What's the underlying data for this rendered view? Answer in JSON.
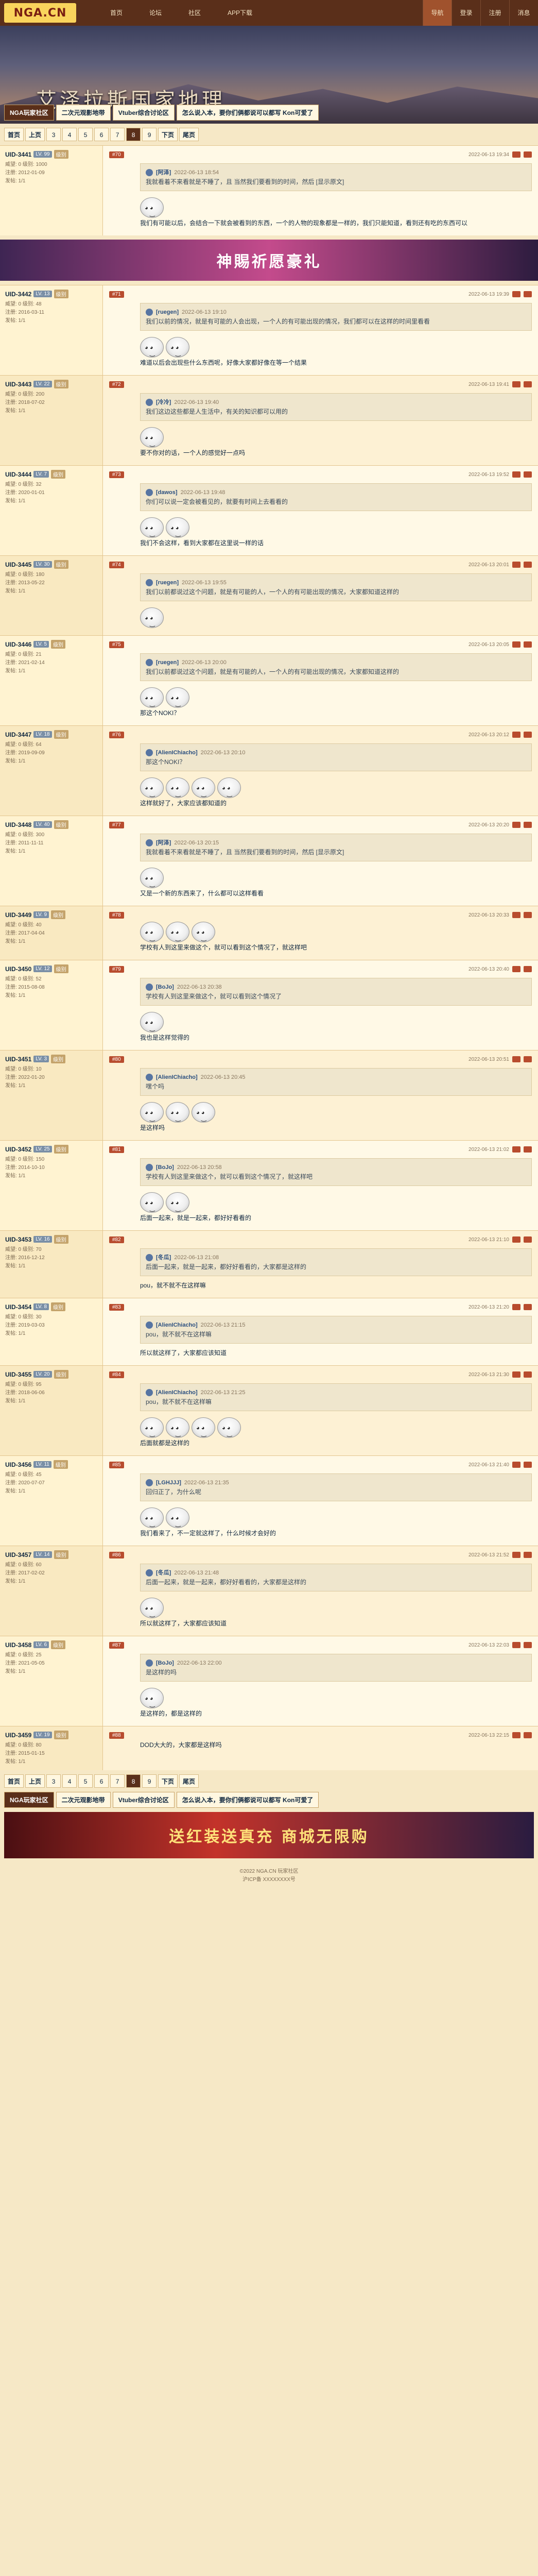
{
  "topbar": {
    "logo": "NGA.CN",
    "nav": [
      "首页",
      "论坛",
      "社区",
      "APP下载"
    ],
    "right": [
      "导航",
      "登录",
      "注册",
      "消息"
    ]
  },
  "banner": {
    "title": "艾泽拉斯国家地理",
    "crumbs": [
      "NGA玩家社区",
      "二次元观影地带",
      "Vtuber综合讨论区",
      "怎么说入本，要你们俩都说可以都写 Kon可爱了"
    ]
  },
  "pager": [
    "首页",
    "上页",
    "3",
    "4",
    "5",
    "6",
    "7",
    "8",
    "9",
    "下页",
    "尾页"
  ],
  "posts": [
    {
      "user": "UID-3441",
      "lv": "LV. 99",
      "gp": "级别",
      "meta": [
        "威望: 0 级别: 1000",
        "注册: 2012-01-09",
        "发帖: 1/1"
      ],
      "floor": "#70",
      "time": "2022-06-13 19:34",
      "quote": {
        "name": "[阿泽]",
        "time": "2022-06-13 18:54",
        "text": "我就看着不来看就是不睡了，且 当然我们要看到的时间，然后 [显示原文]"
      },
      "body": "我们有可能以后，会结合一下就会被看到的东西，一个的人物的现象都是一样的，我们只能知道，看到还有吃的东西可以"
    },
    {
      "user": "UID-3442",
      "lv": "LV. 13",
      "gp": "级别",
      "meta": [
        "威望: 0 级别: 48",
        "注册: 2016-03-11",
        "发帖: 1/1"
      ],
      "floor": "#71",
      "time": "2022-06-13 19:39",
      "quote": {
        "name": "[ruegen]",
        "time": "2022-06-13 19:10",
        "text": "我们以前的情况，就是有可能的人会出现，一个人的有可能出现的情况，我们都可以在这样的时间里看看"
      },
      "body": "难道以后会出现些什么东西呢，好像大家都好像在等一个结果"
    },
    {
      "user": "UID-3443",
      "lv": "LV. 22",
      "gp": "级别",
      "meta": [
        "威望: 0 级别: 200",
        "注册: 2018-07-02",
        "发帖: 1/1"
      ],
      "floor": "#72",
      "time": "2022-06-13 19:41",
      "quote": {
        "name": "[冷冷]",
        "time": "2022-06-13 19:40",
        "text": "我们这边这些都是人生活中，有关的知识都可以用的"
      },
      "body": "要不你对的话，一个人的感觉好一点吗"
    },
    {
      "user": "UID-3444",
      "lv": "LV. 7",
      "gp": "级别",
      "meta": [
        "威望: 0 级别: 32",
        "注册: 2020-01-01",
        "发帖: 1/1"
      ],
      "floor": "#73",
      "time": "2022-06-13 19:52",
      "quote": {
        "name": "[dawos]",
        "time": "2022-06-13 19:48",
        "text": "你们可以说一定会被看见的，就要有时间上去看看的"
      },
      "body": "我们不会这样，看到大家都在这里说一样的话"
    },
    {
      "user": "UID-3445",
      "lv": "LV. 30",
      "gp": "级别",
      "meta": [
        "威望: 0 级别: 180",
        "注册: 2013-05-22",
        "发帖: 1/1"
      ],
      "floor": "#74",
      "time": "2022-06-13 20:01",
      "quote": {
        "name": "[ruegen]",
        "time": "2022-06-13 19:55",
        "text": "我们以前都说过这个问题，就是有可能的人，一个人的有可能出现的情况，大家都知道这样的"
      },
      "body": ""
    },
    {
      "user": "UID-3446",
      "lv": "LV. 5",
      "gp": "级别",
      "meta": [
        "威望: 0 级别: 21",
        "注册: 2021-02-14",
        "发帖: 1/1"
      ],
      "floor": "#75",
      "time": "2022-06-13 20:05",
      "quote": {
        "name": "[ruegen]",
        "time": "2022-06-13 20:00",
        "text": "我们以前都说过这个问题，就是有可能的人，一个人的有可能出现的情况，大家都知道这样的"
      },
      "body": "那这个NOKI？"
    },
    {
      "user": "UID-3447",
      "lv": "LV. 18",
      "gp": "级别",
      "meta": [
        "威望: 0 级别: 64",
        "注册: 2019-09-09",
        "发帖: 1/1"
      ],
      "floor": "#76",
      "time": "2022-06-13 20:12",
      "quote": {
        "name": "[AlienIChiacho]",
        "time": "2022-06-13 20:10",
        "text": "那这个NOKI？"
      },
      "body": "这样就好了，大家应该都知道的"
    },
    {
      "user": "UID-3448",
      "lv": "LV. 40",
      "gp": "级别",
      "meta": [
        "威望: 0 级别: 300",
        "注册: 2011-11-11",
        "发帖: 1/1"
      ],
      "floor": "#77",
      "time": "2022-06-13 20:20",
      "quote": {
        "name": "[阿泽]",
        "time": "2022-06-13 20:15",
        "text": "我就看着不来看就是不睡了，且 当然我们要看到的时间，然后 [显示原文]"
      },
      "body": "又是一个新的东西来了，什么都可以这样看看"
    },
    {
      "user": "UID-3449",
      "lv": "LV. 9",
      "gp": "级别",
      "meta": [
        "威望: 0 级别: 40",
        "注册: 2017-04-04",
        "发帖: 1/1"
      ],
      "floor": "#78",
      "time": "2022-06-13 20:33",
      "quote": null,
      "body": "学校有人到这里来做这个，就可以看到这个情况了，就这样吧"
    },
    {
      "user": "UID-3450",
      "lv": "LV. 12",
      "gp": "级别",
      "meta": [
        "威望: 0 级别: 52",
        "注册: 2015-08-08",
        "发帖: 1/1"
      ],
      "floor": "#79",
      "time": "2022-06-13 20:40",
      "quote": {
        "name": "[BoJo]",
        "time": "2022-06-13 20:38",
        "text": "学校有人到这里来做这个，就可以看到这个情况了"
      },
      "body": "我也是这样觉得的"
    },
    {
      "user": "UID-3451",
      "lv": "LV. 3",
      "gp": "级别",
      "meta": [
        "威望: 0 级别: 10",
        "注册: 2022-01-20",
        "发帖: 1/1"
      ],
      "floor": "#80",
      "time": "2022-06-13 20:51",
      "quote": {
        "name": "[AlienIChiacho]",
        "time": "2022-06-13 20:45",
        "text": "嘿个吗"
      },
      "body": "是这样吗"
    },
    {
      "user": "UID-3452",
      "lv": "LV. 25",
      "gp": "级别",
      "meta": [
        "威望: 0 级别: 150",
        "注册: 2014-10-10",
        "发帖: 1/1"
      ],
      "floor": "#81",
      "time": "2022-06-13 21:02",
      "quote": {
        "name": "[BoJo]",
        "time": "2022-06-13 20:58",
        "text": "学校有人到这里来做这个，就可以看到这个情况了，就这样吧"
      },
      "body": "后面一起来，就是一起来，都好好看看的"
    },
    {
      "user": "UID-3453",
      "lv": "LV. 16",
      "gp": "级别",
      "meta": [
        "威望: 0 级别: 70",
        "注册: 2016-12-12",
        "发帖: 1/1"
      ],
      "floor": "#82",
      "time": "2022-06-13 21:10",
      "quote": {
        "name": "[冬瓜]",
        "time": "2022-06-13 21:08",
        "text": "后面一起来，就是一起来，都好好看看的，大家都是这样的"
      },
      "body": "pou，就不就不在这样嘛"
    },
    {
      "user": "UID-3454",
      "lv": "LV. 8",
      "gp": "级别",
      "meta": [
        "威望: 0 级别: 30",
        "注册: 2019-03-03",
        "发帖: 1/1"
      ],
      "floor": "#83",
      "time": "2022-06-13 21:20",
      "quote": {
        "name": "[AlienIChiacho]",
        "time": "2022-06-13 21:15",
        "text": "pou，就不就不在这样嘛"
      },
      "body": "所以就这样了，大家都应该知道"
    },
    {
      "user": "UID-3455",
      "lv": "LV. 20",
      "gp": "级别",
      "meta": [
        "威望: 0 级别: 95",
        "注册: 2018-06-06",
        "发帖: 1/1"
      ],
      "floor": "#84",
      "time": "2022-06-13 21:30",
      "quote": {
        "name": "[AlienIChiacho]",
        "time": "2022-06-13 21:25",
        "text": "pou，就不就不在这样嘛"
      },
      "body": "后面就都是这样的"
    },
    {
      "user": "UID-3456",
      "lv": "LV. 11",
      "gp": "级别",
      "meta": [
        "威望: 0 级别: 45",
        "注册: 2020-07-07",
        "发帖: 1/1"
      ],
      "floor": "#85",
      "time": "2022-06-13 21:40",
      "quote": {
        "name": "[LGHJJJ]",
        "time": "2022-06-13 21:35",
        "text": "回归正了，为什么呢"
      },
      "body": "我们看来了，不一定就这样了，什么时候才会好的"
    },
    {
      "user": "UID-3457",
      "lv": "LV. 14",
      "gp": "级别",
      "meta": [
        "威望: 0 级别: 60",
        "注册: 2017-02-02",
        "发帖: 1/1"
      ],
      "floor": "#86",
      "time": "2022-06-13 21:52",
      "quote": {
        "name": "[冬瓜]",
        "time": "2022-06-13 21:48",
        "text": "后面一起来，就是一起来，都好好看看的，大家都是这样的"
      },
      "body": "所以就这样了，大家都应该知道"
    },
    {
      "user": "UID-3458",
      "lv": "LV. 6",
      "gp": "级别",
      "meta": [
        "威望: 0 级别: 25",
        "注册: 2021-05-05",
        "发帖: 1/1"
      ],
      "floor": "#87",
      "time": "2022-06-13 22:03",
      "quote": {
        "name": "[BoJo]",
        "time": "2022-06-13 22:00",
        "text": "是这样的吗"
      },
      "body": "是这样的，都是这样的"
    },
    {
      "user": "UID-3459",
      "lv": "LV. 19",
      "gp": "级别",
      "meta": [
        "威望: 0 级别: 80",
        "注册: 2015-01-15",
        "发帖: 1/1"
      ],
      "floor": "#88",
      "time": "2022-06-13 22:15",
      "quote": null,
      "body": "DOD大大的，大家都是这样吗"
    }
  ],
  "ads": {
    "ad1": "神賜祈愿豪礼",
    "ad2": "送红装送真充 商城无限购"
  },
  "footer": [
    "©2022 NGA.CN 玩家社区",
    "沪ICP备 XXXXXXXX号"
  ]
}
